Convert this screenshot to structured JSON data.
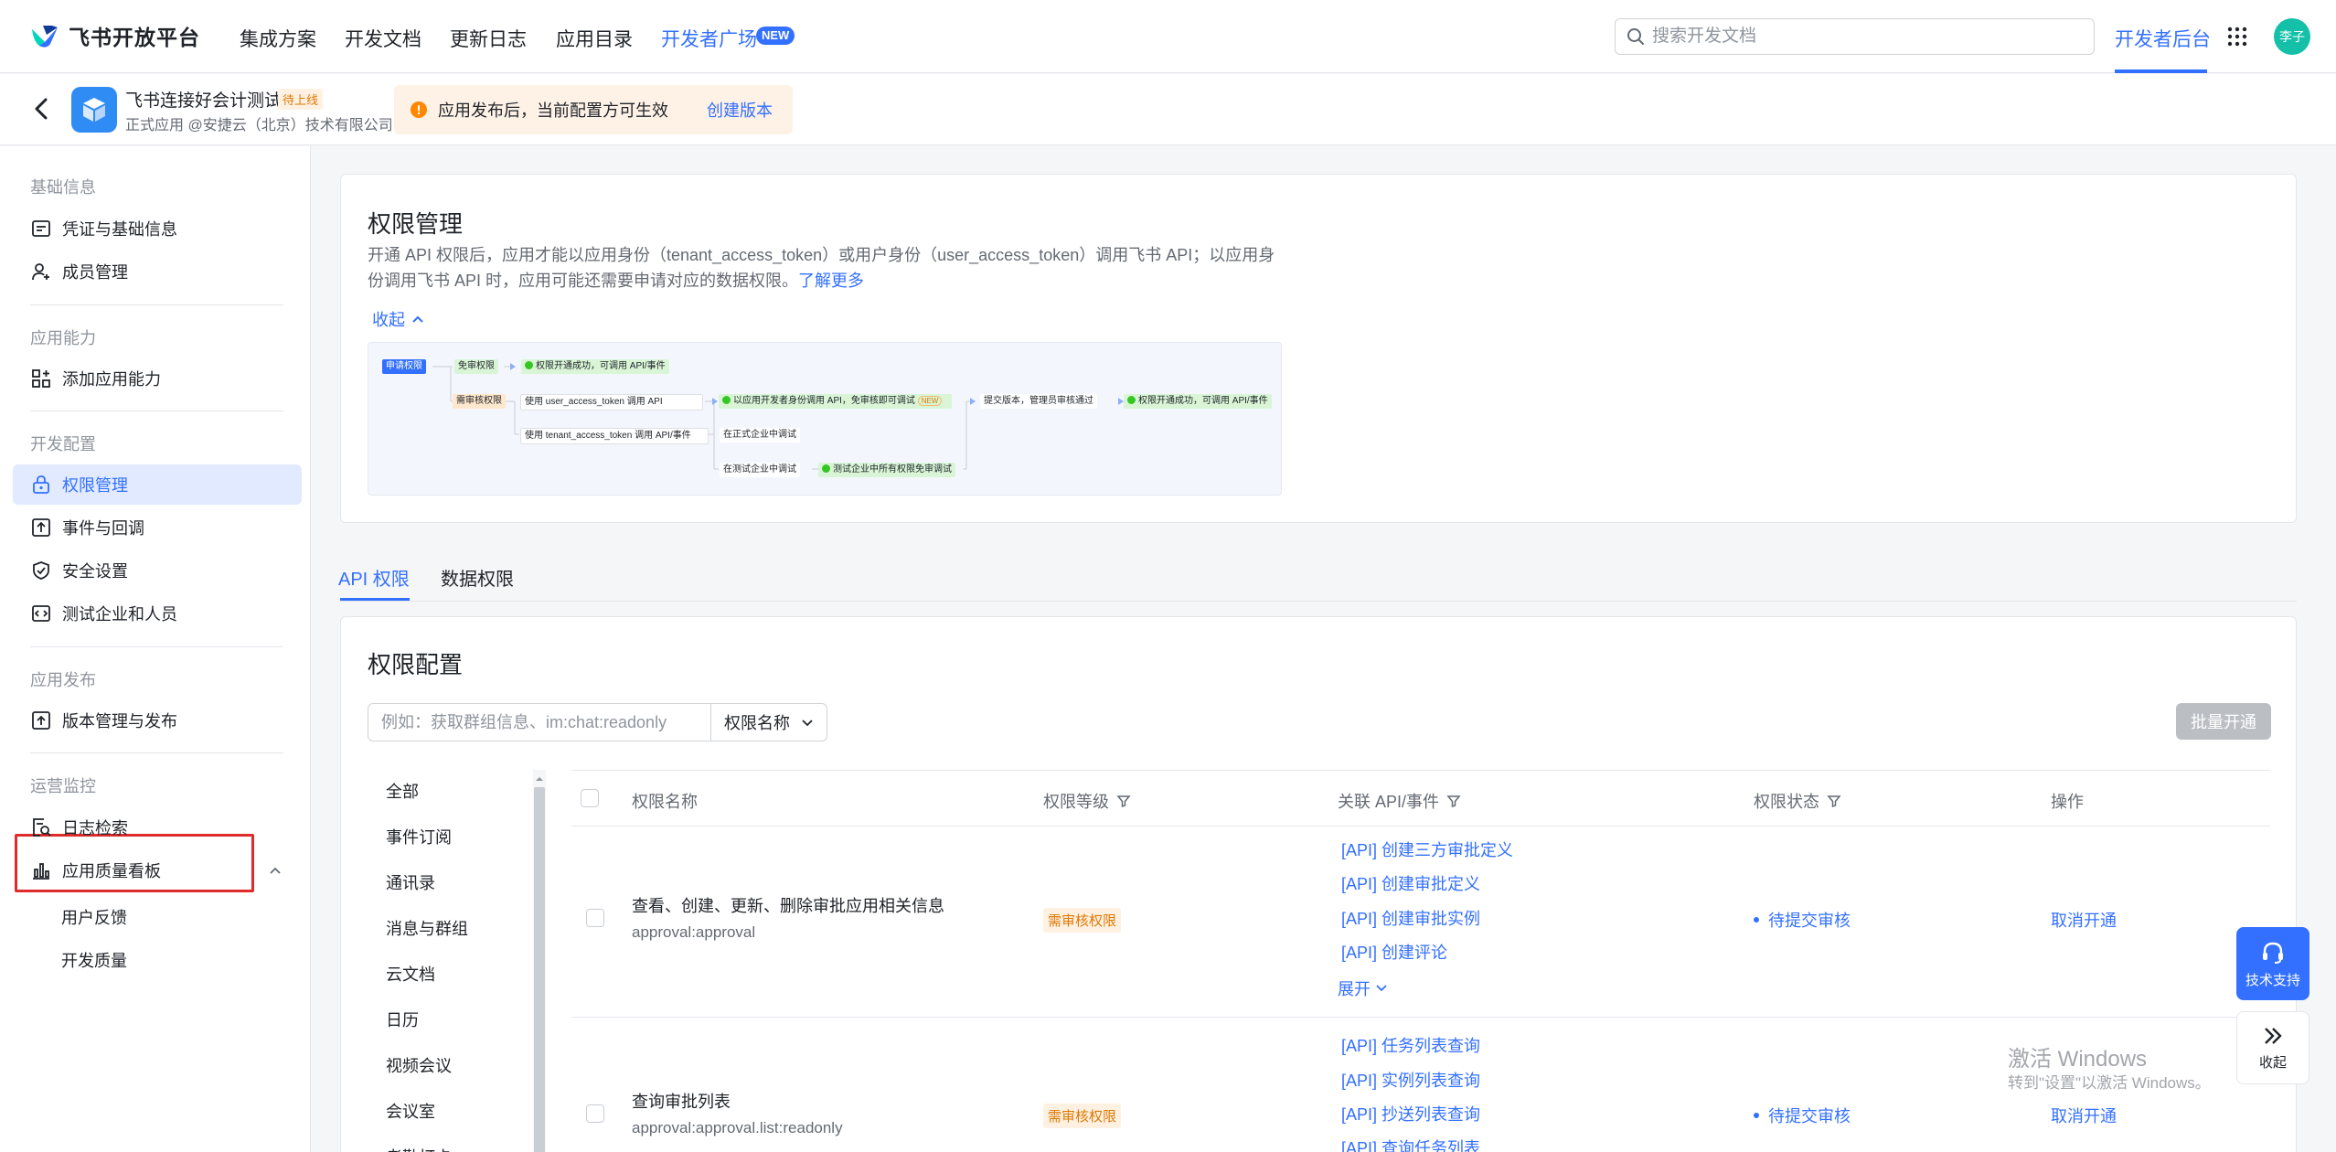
{
  "topnav": {
    "logo_text": "飞书开放平台",
    "links": [
      "集成方案",
      "开发文档",
      "更新日志",
      "应用目录",
      "开发者广场"
    ],
    "new_badge": "NEW",
    "search_placeholder": "搜索开发文档",
    "console": "开发者后台",
    "avatar": "李子"
  },
  "app": {
    "name": "飞书连接好会计测试",
    "tag": "待上线",
    "sub": "正式应用 @安捷云（北京）技术有限公司",
    "notice": "应用发布后，当前配置方可生效",
    "notice_link": "创建版本"
  },
  "sidebar": {
    "groups": [
      "基础信息",
      "应用能力",
      "开发配置",
      "应用发布",
      "运营监控"
    ],
    "items": [
      {
        "label": "凭证与基础信息",
        "icon": "id-card-icon"
      },
      {
        "label": "成员管理",
        "icon": "person-add-icon"
      },
      {
        "label": "添加应用能力",
        "icon": "apps-add-icon"
      },
      {
        "label": "权限管理",
        "icon": "lock-icon"
      },
      {
        "label": "事件与回调",
        "icon": "event-icon"
      },
      {
        "label": "安全设置",
        "icon": "shield-icon"
      },
      {
        "label": "测试企业和人员",
        "icon": "code-icon"
      },
      {
        "label": "版本管理与发布",
        "icon": "upload-icon"
      },
      {
        "label": "日志检索",
        "icon": "log-search-icon"
      },
      {
        "label": "应用质量看板",
        "icon": "bar-chart-icon"
      }
    ],
    "subitems": [
      "用户反馈",
      "开发质量"
    ]
  },
  "perm_intro": {
    "title": "权限管理",
    "desc": "开通 API 权限后，应用才能以应用身份（tenant_access_token）或用户身份（user_access_token）调用飞书 API；以应用身份调用飞书 API 时，应用可能还需要申请对应的数据权限。",
    "learn_more": "了解更多",
    "collapse": "收起"
  },
  "flow": {
    "apply": "申请权限",
    "free": "免审权限",
    "review": "需审核权限",
    "success1": "权限开通成功，可调用 API/事件",
    "user_token": "使用 user_access_token 调用 API",
    "tenant_token": "使用 tenant_access_token 调用 API/事件",
    "dev_identity": "以应用开发者身份调用 API，免审核即可调试",
    "new": "NEW",
    "submit": "提交版本，管理员审核通过",
    "success2": "权限开通成功，可调用 API/事件",
    "prod_debug": "在正式企业中调试",
    "test_debug": "在测试企业中调试",
    "test_free": "测试企业中所有权限免审调试"
  },
  "tabs": [
    "API 权限",
    "数据权限"
  ],
  "config": {
    "title": "权限配置",
    "filter_placeholder": "例如：获取群组信息、im:chat:readonly",
    "filter_select": "权限名称",
    "batch": "批量开通",
    "categories": [
      "全部",
      "事件订阅",
      "通讯录",
      "消息与群组",
      "云文档",
      "日历",
      "视频会议",
      "会议室",
      "考勤打卡"
    ],
    "headers": [
      "权限名称",
      "权限等级",
      "关联 API/事件",
      "权限状态",
      "操作"
    ],
    "rows": [
      {
        "name": "查看、创建、更新、删除审批应用相关信息",
        "code": "approval:approval",
        "level": "需审核权限",
        "apis": [
          "[API] 创建三方审批定义",
          "[API] 创建审批定义",
          "[API] 创建审批实例",
          "[API] 创建评论"
        ],
        "expand": "展开",
        "status": "待提交审核",
        "op": "取消开通"
      },
      {
        "name": "查询审批列表",
        "code": "approval:approval.list:readonly",
        "level": "需审核权限",
        "apis": [
          "[API] 任务列表查询",
          "[API] 实例列表查询",
          "[API] 抄送列表查询",
          "[API] 查询任务列表"
        ],
        "status": "待提交审核",
        "op": "取消开通"
      }
    ]
  },
  "float": {
    "support": "技术支持",
    "collapse": "收起"
  },
  "watermark": {
    "line1": "激活 Windows",
    "line2": "转到\"设置\"以激活 Windows。"
  }
}
